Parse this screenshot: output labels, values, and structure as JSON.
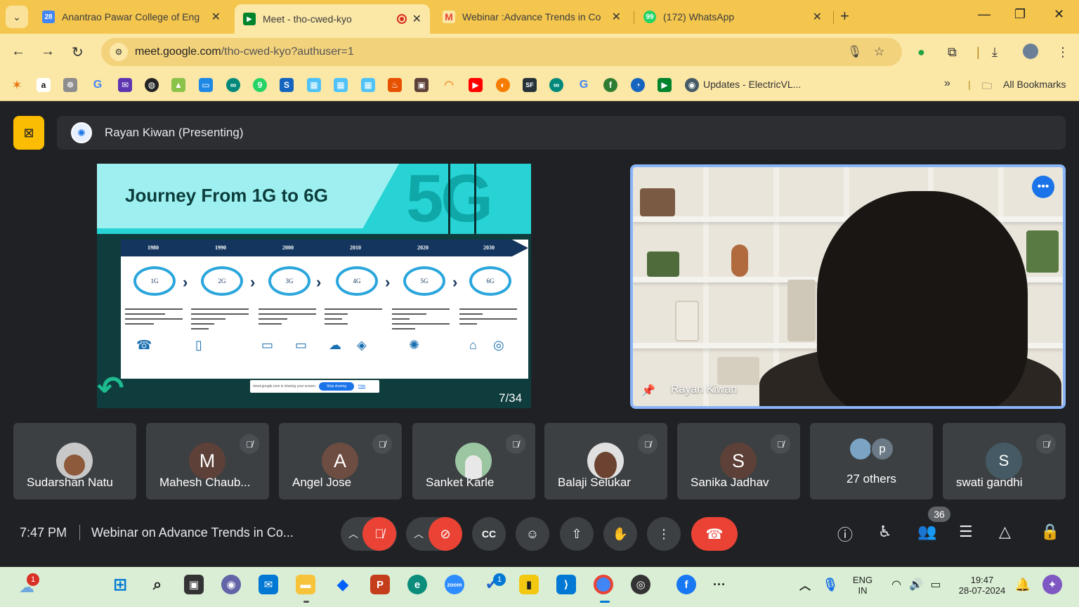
{
  "browser": {
    "tabs": [
      {
        "title": "Anantrao Pawar College of Eng",
        "favicon": "calendar-icon",
        "close": "✕"
      },
      {
        "title": "Meet - tho-cwed-kyo",
        "favicon": "meet-icon",
        "close": "✕"
      },
      {
        "title": "Webinar :Advance Trends in Co",
        "favicon": "gmail-icon",
        "close": "✕"
      },
      {
        "title": "(172) WhatsApp",
        "favicon": "whatsapp-icon",
        "close": "✕"
      }
    ],
    "new_tab": "+",
    "url_host": "meet.google.com",
    "url_path": "/tho-cwed-kyo?authuser=1",
    "bookmark_updates": "Updates - ElectricVL...",
    "overflow": "»",
    "all_bookmarks": "All Bookmarks"
  },
  "meet": {
    "presenter_label": "Rayan Kiwan (Presenting)",
    "slide": {
      "title": "Journey From 1G to 6G",
      "big_text": "5G",
      "years": [
        "1980",
        "1990",
        "2000",
        "2010",
        "2020",
        "2030"
      ],
      "generations": [
        "1G",
        "2G",
        "3G",
        "4G",
        "5G",
        "6G"
      ],
      "share_notice": "meet.google.com is sharing your screen.",
      "stop_sharing": "Stop sharing",
      "hide": "Hide",
      "page": "7/34"
    },
    "camera_name": "Rayan Kiwan",
    "participants": [
      {
        "name": "Sudarshan Natu",
        "initial": "",
        "color": "#c8c8c8",
        "muted": false
      },
      {
        "name": "Mahesh Chaub...",
        "initial": "M",
        "color": "#5d4037",
        "muted": true
      },
      {
        "name": "Angel Jose",
        "initial": "A",
        "color": "#6d4c41",
        "muted": true
      },
      {
        "name": "Sanket Karle",
        "initial": "",
        "color": "#9cc5a1",
        "muted": true
      },
      {
        "name": "Balaji Selukar",
        "initial": "",
        "color": "#e0e0e0",
        "muted": true
      },
      {
        "name": "Sanika Jadhav",
        "initial": "S",
        "color": "#5d4037",
        "muted": true
      },
      {
        "name": "swati gandhi",
        "initial": "S",
        "color": "#455a64",
        "muted": true
      }
    ],
    "others_label": "27 others",
    "others_initial": "p",
    "clock": "7:47 PM",
    "meeting_title": "Webinar on Advance Trends in Co...",
    "people_count": "36"
  },
  "taskbar": {
    "weather_badge": "1",
    "todo_badge": "1",
    "lang_top": "ENG",
    "lang_bottom": "IN",
    "time": "19:47",
    "date": "28-07-2024"
  },
  "colors": {
    "chrome_frame": "#f4c64e",
    "meet_bg": "#202124",
    "tile_bg": "#3c4043",
    "danger": "#ea4335",
    "accent": "#8ab4f8",
    "present_yellow": "#fbbc04"
  }
}
